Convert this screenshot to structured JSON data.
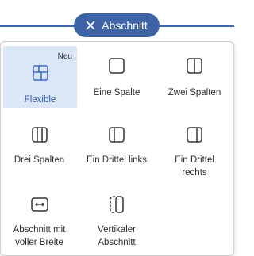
{
  "pill": {
    "label": "Abschnitt",
    "icon": "close-icon"
  },
  "colors": {
    "accent": "#3e63a4",
    "selected_bg": "#dbe6f6",
    "selected_text": "#2f5da8"
  },
  "options": [
    {
      "label": "Flexible",
      "icon": "flexible-layout-icon",
      "badge": "Neu",
      "selected": true
    },
    {
      "label": "Eine Spalte",
      "icon": "one-column-icon"
    },
    {
      "label": "Zwei Spalten",
      "icon": "two-columns-icon"
    },
    {
      "label": "Drei Spalten",
      "icon": "three-columns-icon"
    },
    {
      "label": "Ein Drittel links",
      "icon": "one-third-left-icon"
    },
    {
      "label": "Ein Drittel\nrechts",
      "icon": "one-third-right-icon"
    },
    {
      "label": "Abschnitt mit\nvoller Breite",
      "icon": "full-width-section-icon"
    },
    {
      "label": "Vertikaler\nAbschnitt",
      "icon": "vertical-section-icon"
    }
  ]
}
